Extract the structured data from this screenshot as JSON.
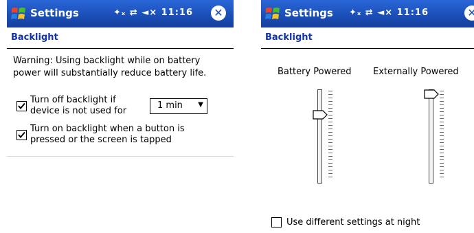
{
  "left_screen": {
    "title": "Settings",
    "status_icons": "✦ₓ ⇄ ◄×",
    "time": "11:16",
    "page_heading": "Backlight",
    "warning_text": "Warning: Using backlight while on battery power will substantially reduce battery life.",
    "options": [
      {
        "label_line1": "Turn off backlight if",
        "label_line2": "device is not used for",
        "checked": true
      },
      {
        "label_line1": "Turn on backlight when a button is",
        "label_line2": "pressed or the screen is tapped",
        "checked": true
      }
    ],
    "timeout_select": {
      "value": "1 min"
    }
  },
  "right_screen": {
    "title": "Settings",
    "status_icons": "✦ₓ ⇄ ◄×",
    "time": "11:16",
    "page_heading": "Backlight",
    "sliders": [
      {
        "label": "Battery Powered",
        "level_percent": 75
      },
      {
        "label": "Externally Powered",
        "level_percent": 100
      }
    ],
    "night_option": {
      "label": "Use different settings at night",
      "checked": false
    }
  },
  "colors": {
    "titlebar": "#1b4fb8",
    "heading_text": "#1133aa"
  }
}
